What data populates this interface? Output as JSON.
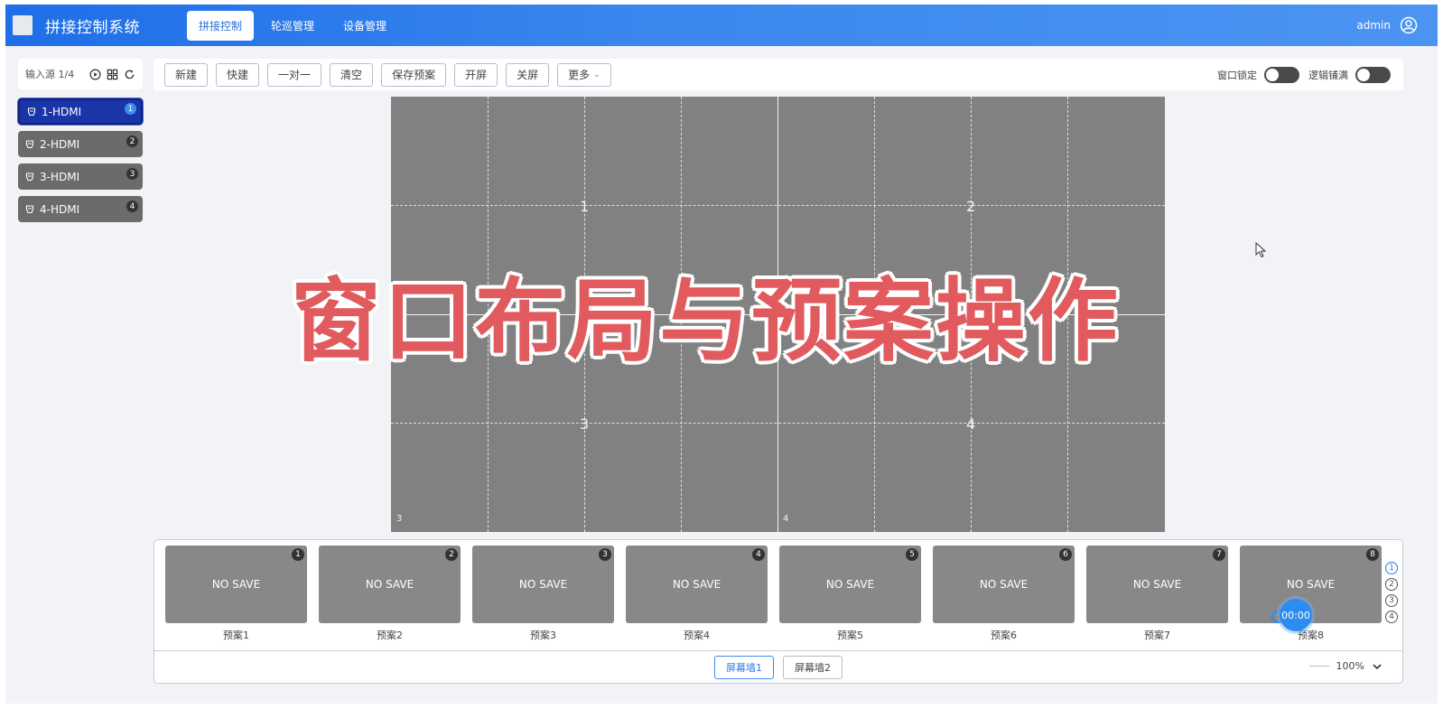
{
  "header": {
    "app_title": "拼接控制系统",
    "nav": [
      {
        "label": "拼接控制",
        "active": true
      },
      {
        "label": "轮巡管理",
        "active": false
      },
      {
        "label": "设备管理",
        "active": false
      }
    ],
    "username": "admin"
  },
  "sidebar": {
    "title": "输入源 1/4",
    "items": [
      {
        "label": "1-HDMI",
        "badge": "1",
        "active": true
      },
      {
        "label": "2-HDMI",
        "badge": "2",
        "active": false
      },
      {
        "label": "3-HDMI",
        "badge": "3",
        "active": false
      },
      {
        "label": "4-HDMI",
        "badge": "4",
        "active": false
      }
    ]
  },
  "toolbar": {
    "buttons": [
      "新建",
      "快建",
      "一对一",
      "清空",
      "保存预案",
      "开屏",
      "关屏"
    ],
    "more_label": "更多",
    "window_lock_label": "窗口锁定",
    "logic_fill_label": "逻辑铺满"
  },
  "canvas": {
    "screen_labels": [
      "1",
      "2",
      "3",
      "4"
    ],
    "corner_labels": [
      "3",
      "4"
    ]
  },
  "overlay_title": "窗口布局与预案操作",
  "presets": {
    "items": [
      {
        "num": "1",
        "thumb_text": "NO SAVE",
        "name": "预案1"
      },
      {
        "num": "2",
        "thumb_text": "NO SAVE",
        "name": "预案2"
      },
      {
        "num": "3",
        "thumb_text": "NO SAVE",
        "name": "预案3"
      },
      {
        "num": "4",
        "thumb_text": "NO SAVE",
        "name": "预案4"
      },
      {
        "num": "5",
        "thumb_text": "NO SAVE",
        "name": "预案5"
      },
      {
        "num": "6",
        "thumb_text": "NO SAVE",
        "name": "预案6"
      },
      {
        "num": "7",
        "thumb_text": "NO SAVE",
        "name": "预案7"
      },
      {
        "num": "8",
        "thumb_text": "NO SAVE",
        "name": "预案8"
      }
    ],
    "pages": [
      "1",
      "2",
      "3",
      "4"
    ],
    "walls": [
      {
        "label": "屏幕墙1",
        "active": true
      },
      {
        "label": "屏幕墙2",
        "active": false
      }
    ],
    "zoom": "100%",
    "timer": "00:00"
  },
  "colors": {
    "header_start": "#1e6ee8",
    "header_end": "#4b94f2",
    "accent": "#2f7ae6",
    "active_source": "#1a35a8",
    "overlay_red": "#e05a5e",
    "canvas_gray": "#818181"
  }
}
